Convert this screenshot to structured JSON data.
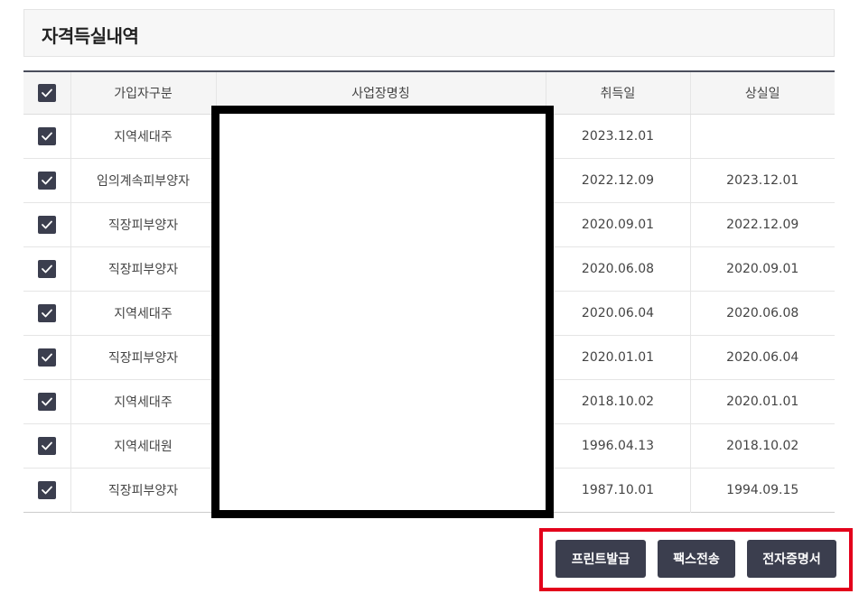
{
  "section_title": "자격득실내역",
  "table": {
    "headers": {
      "type": "가입자구분",
      "workplace": "사업장명칭",
      "acquired": "취득일",
      "lost": "상실일"
    },
    "rows": [
      {
        "checked": true,
        "type": "지역세대주",
        "workplace": "",
        "acquired": "2023.12.01",
        "lost": ""
      },
      {
        "checked": true,
        "type": "임의계속피부양자",
        "workplace": "",
        "acquired": "2022.12.09",
        "lost": "2023.12.01"
      },
      {
        "checked": true,
        "type": "직장피부양자",
        "workplace": "",
        "acquired": "2020.09.01",
        "lost": "2022.12.09"
      },
      {
        "checked": true,
        "type": "직장피부양자",
        "workplace": "",
        "acquired": "2020.06.08",
        "lost": "2020.09.01"
      },
      {
        "checked": true,
        "type": "지역세대주",
        "workplace": "",
        "acquired": "2020.06.04",
        "lost": "2020.06.08"
      },
      {
        "checked": true,
        "type": "직장피부양자",
        "workplace": "",
        "acquired": "2020.01.01",
        "lost": "2020.06.04"
      },
      {
        "checked": true,
        "type": "지역세대주",
        "workplace": "",
        "acquired": "2018.10.02",
        "lost": "2020.01.01"
      },
      {
        "checked": true,
        "type": "지역세대원",
        "workplace": "",
        "acquired": "1996.04.13",
        "lost": "2018.10.02"
      },
      {
        "checked": true,
        "type": "직장피부양자",
        "workplace": "",
        "acquired": "1987.10.01",
        "lost": "1994.09.15"
      }
    ]
  },
  "buttons": {
    "print": "프린트발급",
    "fax": "팩스전송",
    "e_cert": "전자증명서"
  },
  "icons": {
    "checkbox": "checkmark-icon"
  },
  "colors": {
    "accent": "#3b3e4e",
    "highlight_frame": "#e3001b",
    "redaction": "#000000"
  }
}
